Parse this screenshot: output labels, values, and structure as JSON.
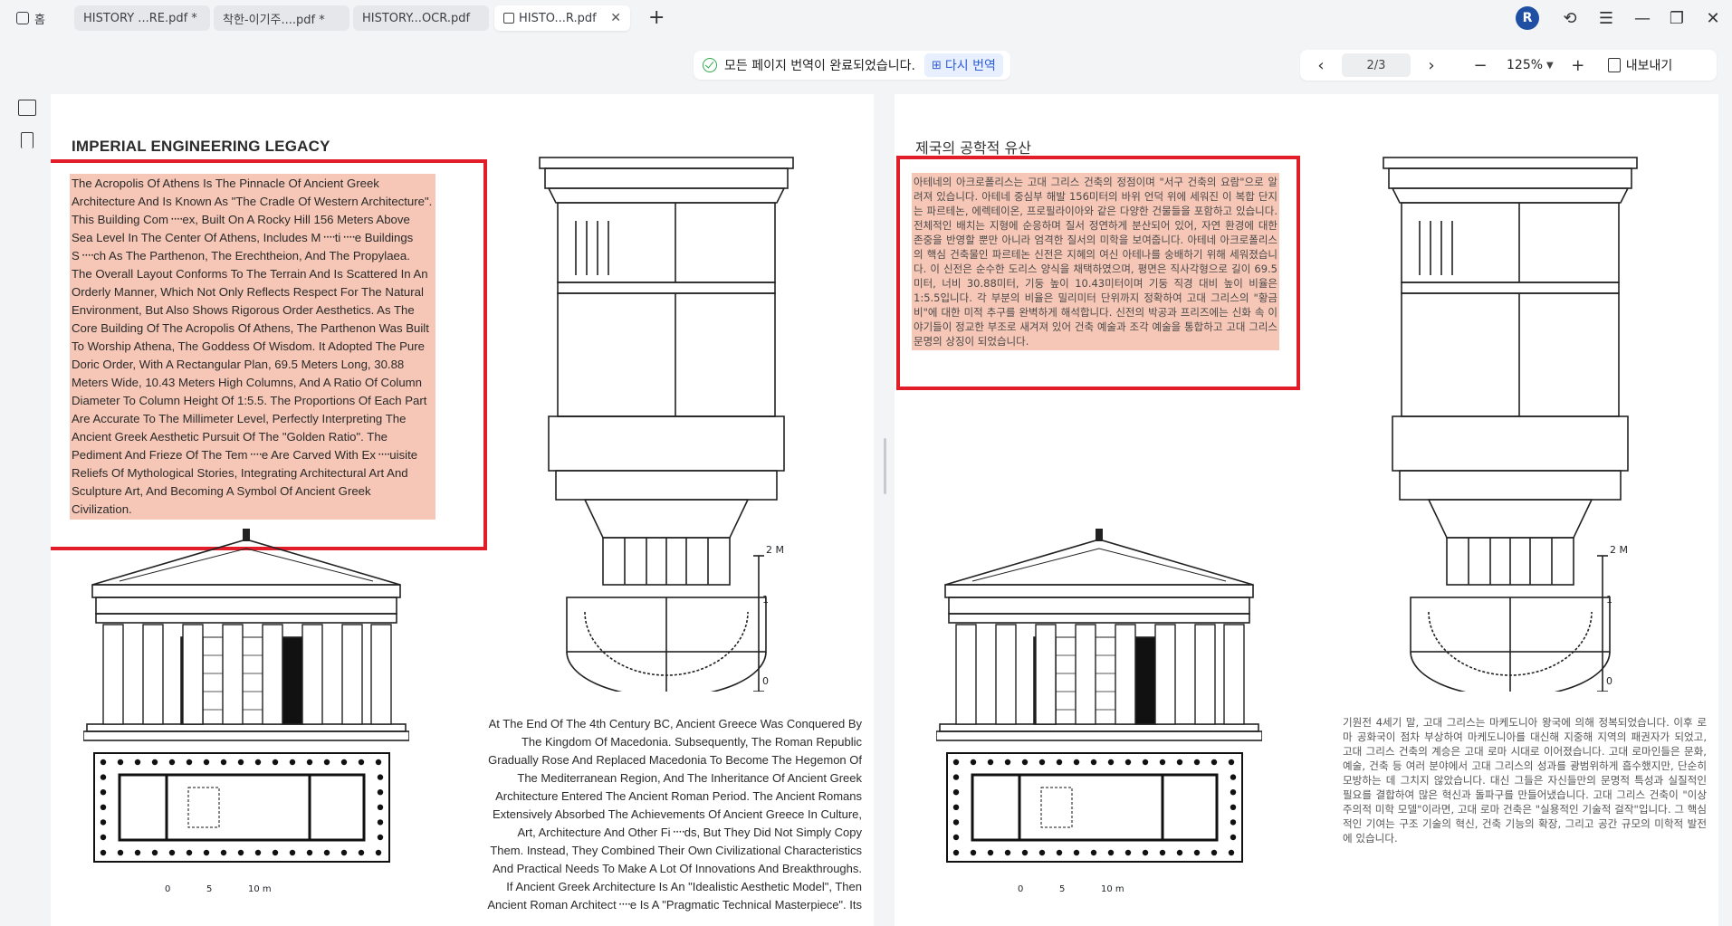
{
  "tabs": [
    {
      "label": "홈"
    },
    {
      "label": "HISTORY ...RE.pdf *"
    },
    {
      "label": "착한-이기주....pdf *"
    },
    {
      "label": "HISTORY...OCR.pdf"
    },
    {
      "label": "HISTO...R.pdf"
    }
  ],
  "user": {
    "initial": "R"
  },
  "toolbar": {
    "status_text": "모든 페이지 번역이 완료되었습니다.",
    "retranslate_label": "다시 번역",
    "page_indicator": "2/3",
    "zoom": "125%",
    "export_label": "내보내기"
  },
  "left_page": {
    "title": "IMPERIAL ENGINEERING LEGACY",
    "highlight_text": "The Acropolis Of Athens Is The Pinnacle Of Ancient Greek Architecture And Is Known As \"The Cradle Of Western Architecture\". This Building Com᠁ex, Built On A Rocky Hill 156 Meters Above Sea Level In The Center Of Athens, Includes M᠁ti᠁e Buildings S᠁ch As The Parthenon, The Erechtheion, And The Propylaea. The Overall Layout Conforms To The Terrain And Is Scattered In An Orderly Manner, Which Not Only Reflects Respect For The Natural Environment, But Also Shows Rigorous Order Aesthetics. As The Core Building Of The Acropolis Of Athens, The Parthenon Was Built To Worship Athena, The Goddess Of Wisdom. It Adopted The Pure Doric Order, With A Rectangular Plan, 69.5 Meters Long, 30.88 Meters Wide, 10.43 Meters High Columns, And A Ratio Of Column Diameter To Column Height Of 1:5.5. The Proportions Of Each Part Are Accurate To The Millimeter Level, Perfectly Interpreting The Ancient Greek Aesthetic Pursuit Of The \"Golden Ratio\". The Pediment And Frieze Of The Tem᠁e Are Carved With Ex᠁uisite Reliefs Of Mythological Stories, Integrating Architectural Art And Sculpture Art, And Becoming A Symbol Of Ancient Greek Civilization.",
    "body_text": "At The End Of The 4th Century BC, Ancient Greece Was Conquered By The Kingdom Of Macedonia. Subsequently, The Roman Republic Gradually Rose And Replaced Macedonia To Become The Hegemon Of The Mediterranean Region, And The Inheritance Of Ancient Greek Architecture Entered The Ancient Roman Period. The Ancient Romans Extensively Absorbed The Achievements Of Ancient Greece In Culture, Art, Architecture And Other Fi᠁ds, But They Did Not Simply Copy Them. Instead, They Combined Their Own Civilizational Characteristics And Practical Needs To Make A Lot Of Innovations And Breakthroughs. If Ancient Greek Architecture Is An \"Idealistic Aesthetic Model\", Then Ancient Roman Architect᠁e Is A \"Pragmatic Technical Masterpiece\". Its"
  },
  "right_page": {
    "title": "제국의 공학적 유산",
    "highlight_text": "아테네의 아크로폴리스는 고대 그리스 건축의 정점이며 \"서구 건축의 요람\"으로 알려져 있습니다. 아테네 중심부 해발 156미터의 바위 언덕 위에 세워진 이 복합 단지는 파르테논, 에렉테이온, 프로필라이아와 같은 다양한 건물들을 포함하고 있습니다. 전체적인 배치는 지형에 순응하며 질서 정연하게 분산되어 있어, 자연 환경에 대한 존중을 반영할 뿐만 아니라 엄격한 질서의 미학을 보여줍니다. 아테네 아크로폴리스의 핵심 건축물인 파르테논 신전은 지혜의 여신 아테나를 숭배하기 위해 세워졌습니다. 이 신전은 순수한 도리스 양식을 채택하였으며, 평면은 직사각형으로 길이 69.5미터, 너비 30.88미터, 기둥 높이 10.43미터이며 기둥 직경 대비 높이 비율은 1:5.5입니다. 각 부분의 비율은 밀리미터 단위까지 정확하여 고대 그리스의 \"황금비\"에 대한 미적 추구를 완벽하게 해석합니다. 신전의 박공과 프리즈에는 신화 속 이야기들이 정교한 부조로 새겨져 있어 건축 예술과 조각 예술을 통합하고 고대 그리스 문명의 상징이 되었습니다.",
    "body_text": "기원전 4세기 말, 고대 그리스는 마케도니아 왕국에 의해 정복되었습니다. 이후 로마 공화국이 점차 부상하여 마케도니아를 대신해 지중해 지역의 패권자가 되었고, 고대 그리스 건축의 계승은 고대 로마 시대로 이어졌습니다. 고대 로마인들은 문화, 예술, 건축 등 여러 분야에서 고대 그리스의 성과를 광범위하게 흡수했지만, 단순히 모방하는 데 그치지 않았습니다. 대신 그들은 자신들만의 문명적 특성과 실질적인 필요를 결합하여 많은 혁신과 돌파구를 만들어냈습니다. 고대 그리스 건축이 \"이상주의적 미학 모델\"이라면, 고대 로마 건축은 \"실용적인 기술적 걸작\"입니다. 그 핵심적인 기여는 구조 기술의 혁신, 건축 기능의 확장, 그리고 공간 규모의 미학적 발전에 있습니다."
  },
  "illustration": {
    "scale_top": "2 M",
    "scale_mid": "1",
    "scale_bottom": "0",
    "plan_scale_0": "0",
    "plan_scale_5": "5",
    "plan_scale_10": "10 m"
  }
}
